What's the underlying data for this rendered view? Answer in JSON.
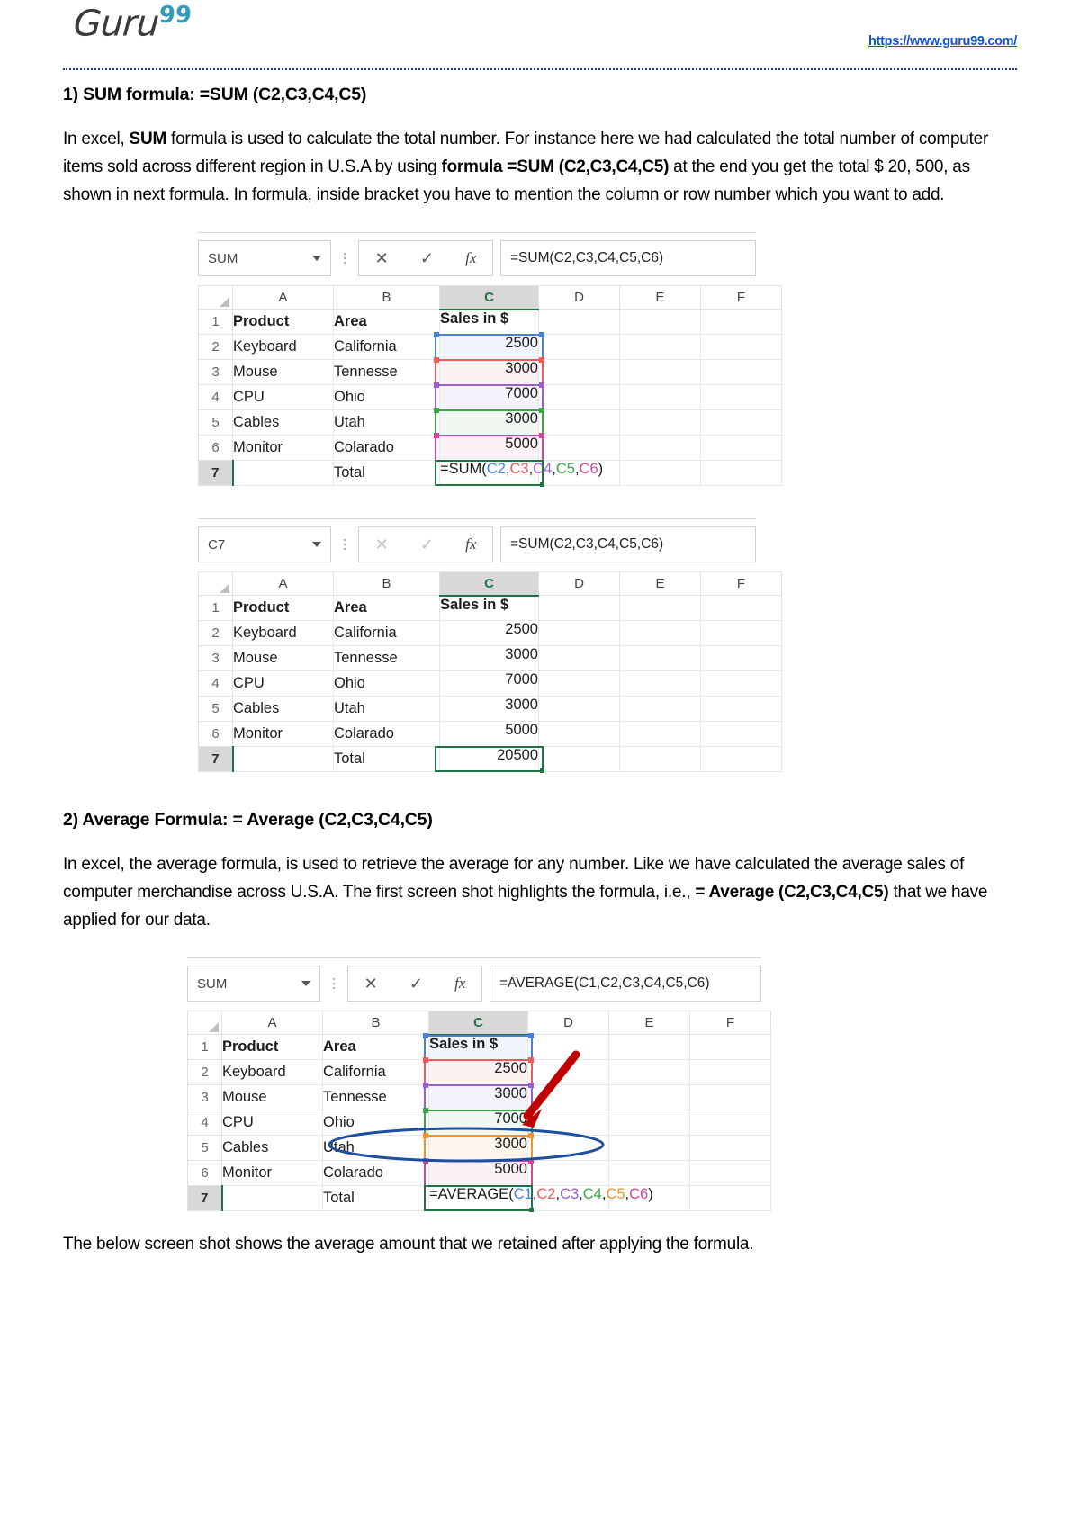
{
  "header": {
    "logo_text": "Guru",
    "logo_sup": "99",
    "url": "https://www.guru99.com/"
  },
  "sections": [
    {
      "heading": "1) SUM formula: =SUM (C2,C3,C4,C5)",
      "paragraph_parts": [
        {
          "t": "In excel, ",
          "b": false
        },
        {
          "t": "SUM",
          "b": true
        },
        {
          "t": " formula is used to calculate the total number. For instance here we had calculated the total number of computer items sold across different region in U.S.A by using ",
          "b": false
        },
        {
          "t": "formula =SUM (C2,C3,C4,C5)",
          "b": true
        },
        {
          "t": " at the end you get the total $ 20, 500, as shown in next formula. In formula, inside bracket you have to mention the column or row number which you want to add.",
          "b": false
        }
      ]
    },
    {
      "heading": "2) Average Formula: = Average (C2,C3,C4,C5)",
      "paragraph_parts": [
        {
          "t": "In excel, the average formula, is used to retrieve the average for any number. Like we have calculated the average sales of computer merchandise across U.S.A. The first screen shot highlights the formula, i.e., ",
          "b": false
        },
        {
          "t": "= Average (C2,C3,C4,C5)",
          "b": true
        },
        {
          "t": " that we have applied for our data.",
          "b": false
        }
      ]
    }
  ],
  "closing_note": "The below screen shot shows the average amount that we retained after applying the formula.",
  "excel_common": {
    "column_headers": [
      "A",
      "B",
      "C",
      "D",
      "E",
      "F"
    ],
    "selected_column": "C",
    "row_numbers": [
      "1",
      "2",
      "3",
      "4",
      "5",
      "6",
      "7"
    ],
    "cancel_icon": "✕",
    "confirm_icon": "✓",
    "fx_icon": "fx",
    "dropdown_icon": "chevron-down-icon",
    "more_icon": "kebab-icon",
    "rows": [
      {
        "a": "Product",
        "b": "Area",
        "c": "Sales in $"
      },
      {
        "a": "Keyboard",
        "b": "California",
        "c": "2500"
      },
      {
        "a": "Mouse",
        "b": "Tennesse",
        "c": "3000"
      },
      {
        "a": "CPU",
        "b": "Ohio",
        "c": "7000"
      },
      {
        "a": "Cables",
        "b": "Utah",
        "c": "3000"
      },
      {
        "a": "Monitor",
        "b": "Colarado",
        "c": "5000"
      },
      {
        "a": "",
        "b": "Total",
        "c": ""
      }
    ]
  },
  "excel_shots": [
    {
      "name": "sum-editing",
      "namebox_value": "SUM",
      "formula_bar_value": "=SUM(C2,C3,C4,C5,C6)",
      "buttons_enabled": true,
      "total_cell_mode": "formula",
      "total_cell_formula_prefix": "=SUM(",
      "total_cell_formula_suffix": ")",
      "total_cell_refs": [
        {
          "text": "C2",
          "color": "#4a7fdc"
        },
        {
          "text": "C3",
          "color": "#f05a5a"
        },
        {
          "text": "C4",
          "color": "#9a5fd0"
        },
        {
          "text": "C5",
          "color": "#3ba44a"
        },
        {
          "text": "C6",
          "color": "#d0479b"
        }
      ],
      "ref_highlights": [
        {
          "row": 2,
          "color": "#4a7fdc",
          "fill": "#f0f4fd"
        },
        {
          "row": 3,
          "color": "#f05a5a",
          "fill": "#fdf1f1"
        },
        {
          "row": 4,
          "color": "#9a5fd0",
          "fill": "#f6f2fb"
        },
        {
          "row": 5,
          "color": "#3ba44a",
          "fill": "#f1f8f2"
        },
        {
          "row": 6,
          "color": "#d0479b",
          "fill": "#fdf1f8"
        }
      ],
      "annotation": "none"
    },
    {
      "name": "sum-result",
      "namebox_value": "C7",
      "formula_bar_value": "=SUM(C2,C3,C4,C5,C6)",
      "buttons_enabled": false,
      "total_cell_mode": "value",
      "total_cell_value": "20500",
      "ref_highlights": [],
      "annotation": "none"
    },
    {
      "name": "average-editing",
      "namebox_value": "SUM",
      "formula_bar_value": "=AVERAGE(C1,C2,C3,C4,C5,C6)",
      "buttons_enabled": true,
      "total_cell_mode": "formula",
      "total_cell_formula_prefix": "=AVERAGE(",
      "total_cell_formula_suffix": ")",
      "total_cell_refs": [
        {
          "text": "C1",
          "color": "#4a7fdc"
        },
        {
          "text": "C2",
          "color": "#f05a5a"
        },
        {
          "text": "C3",
          "color": "#9a5fd0"
        },
        {
          "text": "C4",
          "color": "#3ba44a"
        },
        {
          "text": "C5",
          "color": "#f0932b"
        },
        {
          "text": "C6",
          "color": "#d0479b"
        }
      ],
      "ref_highlights": [
        {
          "row": 1,
          "color": "#4a7fdc",
          "fill": "#f0f4fd"
        },
        {
          "row": 2,
          "color": "#f05a5a",
          "fill": "#fdf1f1"
        },
        {
          "row": 3,
          "color": "#9a5fd0",
          "fill": "#f6f2fb"
        },
        {
          "row": 4,
          "color": "#3ba44a",
          "fill": "#f1f8f2"
        },
        {
          "row": 5,
          "color": "#f0932b",
          "fill": "#fdf6ee"
        },
        {
          "row": 6,
          "color": "#d0479b",
          "fill": "#fdf1f8"
        }
      ],
      "annotation": "red-arrow-and-blue-ellipse",
      "annotation_colors": {
        "arrow": "#c00000",
        "ellipse": "#1f4e9c"
      }
    }
  ]
}
